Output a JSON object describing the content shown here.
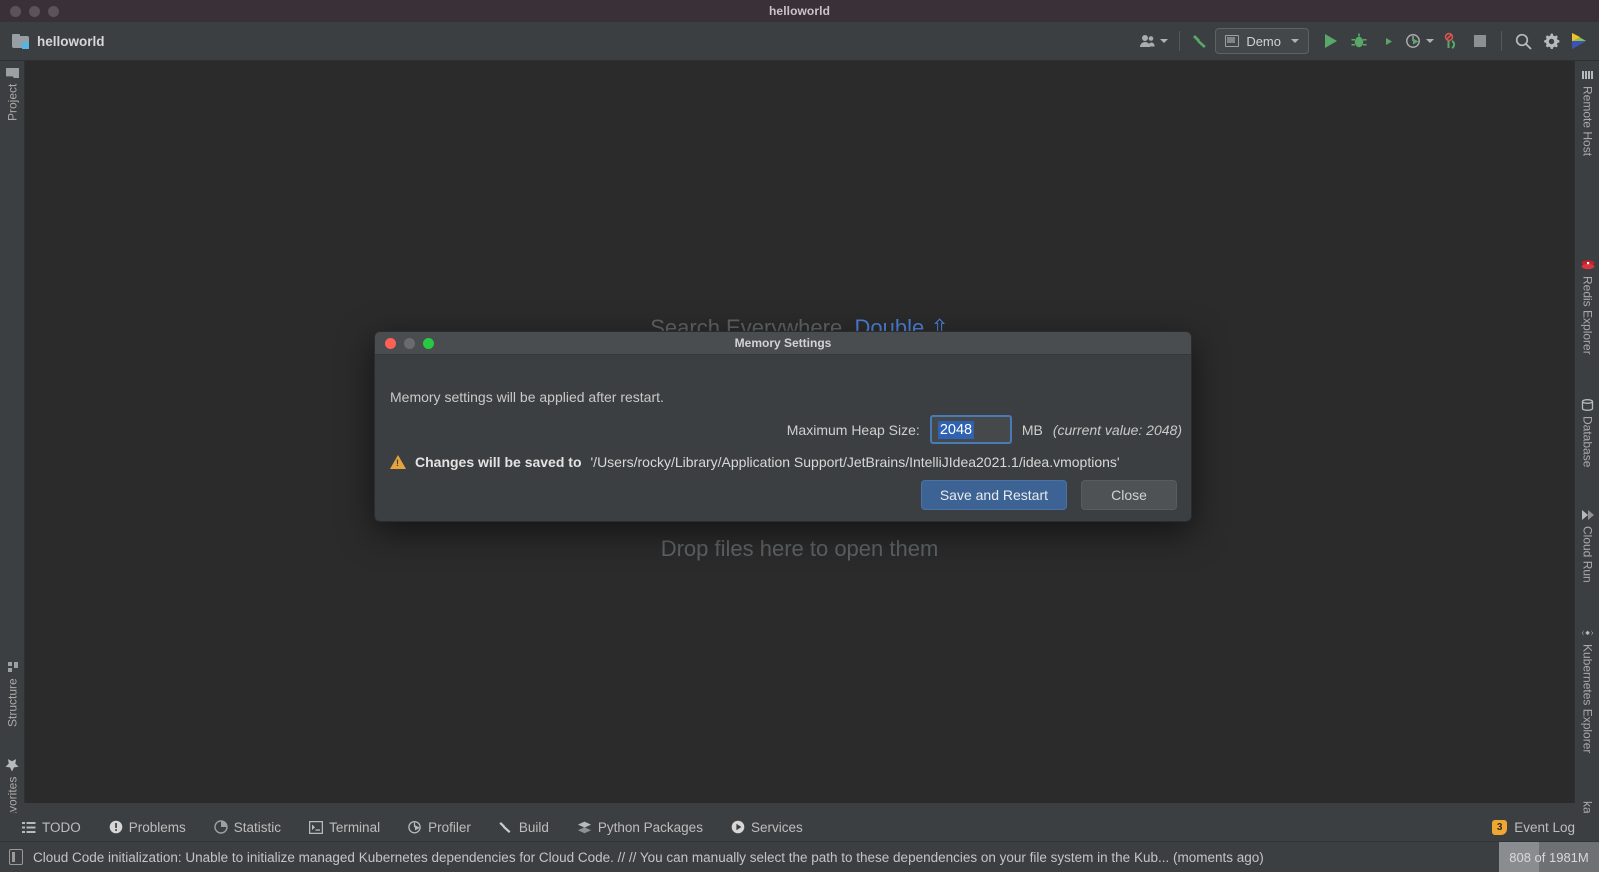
{
  "window": {
    "title": "helloworld"
  },
  "toolbar": {
    "project_name": "helloworld",
    "run_config": "Demo",
    "icons": {
      "avatar": "user-accounts-icon",
      "build": "hammer-build-icon",
      "run": "run-icon",
      "debug": "debug-icon",
      "run_coverage": "run-with-coverage-icon",
      "profiler": "profiler-icon",
      "attach": "attach-to-process-icon",
      "stop": "stop-icon",
      "search": "search-icon",
      "settings": "gear-icon",
      "plugin": "jetbrains-toolbox-icon"
    }
  },
  "left_tabs": [
    {
      "label": "Project",
      "icon": "folder-icon"
    },
    {
      "label": "Structure",
      "icon": "structure-icon"
    },
    {
      "label": "Favorites",
      "icon": "star-icon"
    }
  ],
  "right_tabs": [
    {
      "label": "Remote Host",
      "icon": "remote-host-icon"
    },
    {
      "label": "Redis Explorer",
      "icon": "redis-icon"
    },
    {
      "label": "Database",
      "icon": "database-icon"
    },
    {
      "label": "Cloud Run",
      "icon": "cloud-run-icon"
    },
    {
      "label": "Kubernetes Explorer",
      "icon": "kubernetes-icon"
    },
    {
      "label": "kafkalyt",
      "icon": "kafka-icon"
    }
  ],
  "editor": {
    "watermark_search": "Search Everywhere",
    "watermark_shortcut_word": "Double",
    "watermark_shortcut_key": "⇧",
    "watermark_drop": "Drop files here to open them"
  },
  "bottom_tabs": [
    {
      "label": "TODO",
      "icon": "todo-list-icon"
    },
    {
      "label": "Problems",
      "icon": "problems-icon"
    },
    {
      "label": "Statistic",
      "icon": "statistic-icon"
    },
    {
      "label": "Terminal",
      "icon": "terminal-icon"
    },
    {
      "label": "Profiler",
      "icon": "profiler-icon"
    },
    {
      "label": "Build",
      "icon": "hammer-build-icon"
    },
    {
      "label": "Python Packages",
      "icon": "packages-icon"
    },
    {
      "label": "Services",
      "icon": "services-icon"
    }
  ],
  "event_log": {
    "label": "Event Log",
    "count": "3"
  },
  "status": {
    "icon": "notification-icon",
    "message": "Cloud Code initialization: Unable to initialize managed Kubernetes dependencies for Cloud Code. // // You can manually select the path to these dependencies on your file system in the Kub... (moments ago)",
    "memory": "808 of 1981M"
  },
  "dialog": {
    "title": "Memory Settings",
    "note": "Memory settings will be applied after restart.",
    "heap_label": "Maximum Heap Size:",
    "heap_value": "2048",
    "heap_unit": "MB",
    "heap_current": "(current value: 2048)",
    "warn_bold": "Changes will be saved to",
    "warn_path": "'/Users/rocky/Library/Application Support/JetBrains/IntelliJIdea2021.1/idea.vmoptions'",
    "btn_primary": "Save and Restart",
    "btn_secondary": "Close"
  },
  "colors": {
    "accent_blue": "#4a79b8",
    "run_green": "#59a869",
    "warn_orange": "#e5a43b",
    "editor_bg": "#2b2b2b",
    "panel_bg": "#3c3f41"
  }
}
